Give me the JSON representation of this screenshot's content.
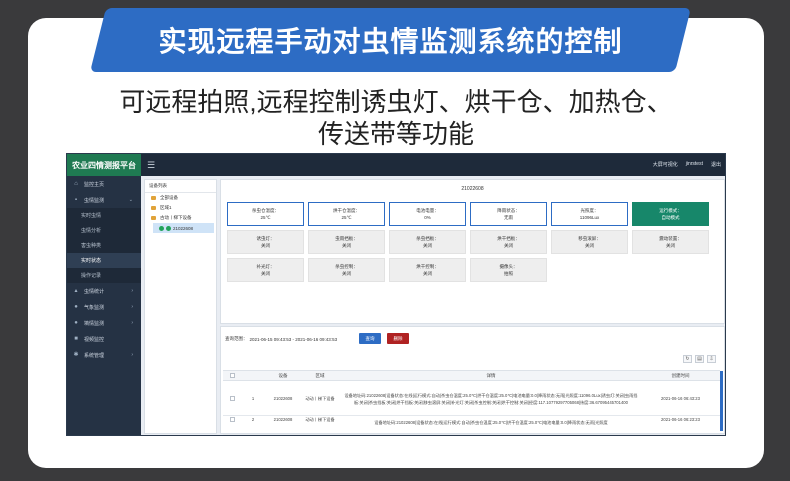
{
  "banner": {
    "title": "实现远程手动对虫情监测系统的控制",
    "subtitle_line1": "可远程拍照,远程控制诱虫灯、烘干仓、加热仓、",
    "subtitle_line2": "传送带等功能"
  },
  "app": {
    "brand": "农业四情测报平台",
    "menu_toggle": "☰",
    "topbar_links": [
      "大屏可视化",
      "jinrstest",
      "退出"
    ]
  },
  "sidebar": {
    "items": [
      {
        "label": "监控主页",
        "icon": "home-icon",
        "glyph": "⌂",
        "chevron": ""
      },
      {
        "label": "虫情监测",
        "icon": "bug-icon",
        "glyph": "▪",
        "chevron": "⌄"
      },
      {
        "label": "实时虫情",
        "sub": true
      },
      {
        "label": "虫情分析",
        "sub": true
      },
      {
        "label": "害虫种类",
        "sub": true
      },
      {
        "label": "实时状态",
        "sub": true,
        "active": true
      },
      {
        "label": "操作记录",
        "sub": true
      },
      {
        "label": "虫情统计",
        "icon": "chart-icon",
        "glyph": "▴",
        "chevron": "›"
      },
      {
        "label": "气象监测",
        "icon": "weather-icon",
        "glyph": "●",
        "chevron": "›"
      },
      {
        "label": "墒情监测",
        "icon": "soil-icon",
        "glyph": "●",
        "chevron": "›"
      },
      {
        "label": "视频监控",
        "icon": "video-icon",
        "glyph": "■",
        "chevron": ""
      },
      {
        "label": "系统管理",
        "icon": "settings-icon",
        "glyph": "✱",
        "chevron": "›"
      }
    ]
  },
  "tree": {
    "header": "设备列表",
    "nodes": [
      {
        "label": "全部设备",
        "level": 1,
        "type": "folder"
      },
      {
        "label": "区域1",
        "level": 1,
        "type": "folder"
      },
      {
        "label": "古动丨梯下设备",
        "level": 1,
        "type": "folder"
      },
      {
        "label": "21022608",
        "level": 2,
        "type": "device",
        "selected": true
      }
    ]
  },
  "device": {
    "id": "21022608",
    "status_boxes": [
      {
        "label": "杀虫仓温度：",
        "value": "25℃",
        "style": "blue"
      },
      {
        "label": "烘干仓温度：",
        "value": "25℃",
        "style": "blue"
      },
      {
        "label": "电池电量：",
        "value": "0%",
        "style": "blue"
      },
      {
        "label": "降雨状态：",
        "value": "无雨",
        "style": "blue"
      },
      {
        "label": "光照度：",
        "value": "11096Lux",
        "style": "blue"
      },
      {
        "label": "运行模式：",
        "value": "自动模式",
        "style": "green"
      },
      {
        "label": "诱虫灯：",
        "value": "关闭",
        "style": "gray"
      },
      {
        "label": "虫雨挡板：",
        "value": "关闭",
        "style": "gray"
      },
      {
        "label": "杀虫挡板：",
        "value": "关闭",
        "style": "gray"
      },
      {
        "label": "烘干挡板：",
        "value": "关闭",
        "style": "gray"
      },
      {
        "label": "移虫滚屏：",
        "value": "关闭",
        "style": "gray"
      },
      {
        "label": "震动装置：",
        "value": "关闭",
        "style": "gray"
      },
      {
        "label": "补光灯：",
        "value": "关闭",
        "style": "gray"
      },
      {
        "label": "杀虫控制：",
        "value": "关闭",
        "style": "gray"
      },
      {
        "label": "烘干控制：",
        "value": "关闭",
        "style": "gray"
      },
      {
        "label": "摄像头：",
        "value": "拍照",
        "style": "gray"
      }
    ]
  },
  "query": {
    "label": "查询范围：",
    "range": "2021-06-15 09:43:53 - 2021-06-16 09:43:53",
    "query_button": "查询",
    "delete_button": "删除"
  },
  "table": {
    "headers": [
      "",
      "",
      "设备",
      "区域",
      "详情",
      "创建时间"
    ],
    "rows": [
      {
        "index": "1",
        "device": "21022608",
        "region": "动动丨梯下设备",
        "detail": "设备地址码:21022608|设备状态:在线|运行模式:自动|杀虫仓温度:25.0℃|烘干仓温度:25.0℃|电池电量:0.0|降雨状态:无雨|光照度:11096.0Lux|诱虫灯:关闭|虫雨挡板:关闭|杀虫挡板:关闭|烘干挡板:关闭|移虫滚屏:关闭|补光灯:关闭|杀虫控制:关闭|烘干控制:关闭|经度:117.10779297705068|纬度:36.67095445701400",
        "time": "2021-06-16 06:43:23"
      },
      {
        "index": "2",
        "device": "21022608",
        "region": "动动丨梯下设备",
        "detail": "设备地址码:21022608|设备状态:在线|运行模式:自动|杀虫仓温度:25.0℃|烘干仓温度:25.0℃|电池电量:0.0|降雨状态:无雨|光照度",
        "time": "2021-06-16 06:23:23"
      }
    ]
  }
}
